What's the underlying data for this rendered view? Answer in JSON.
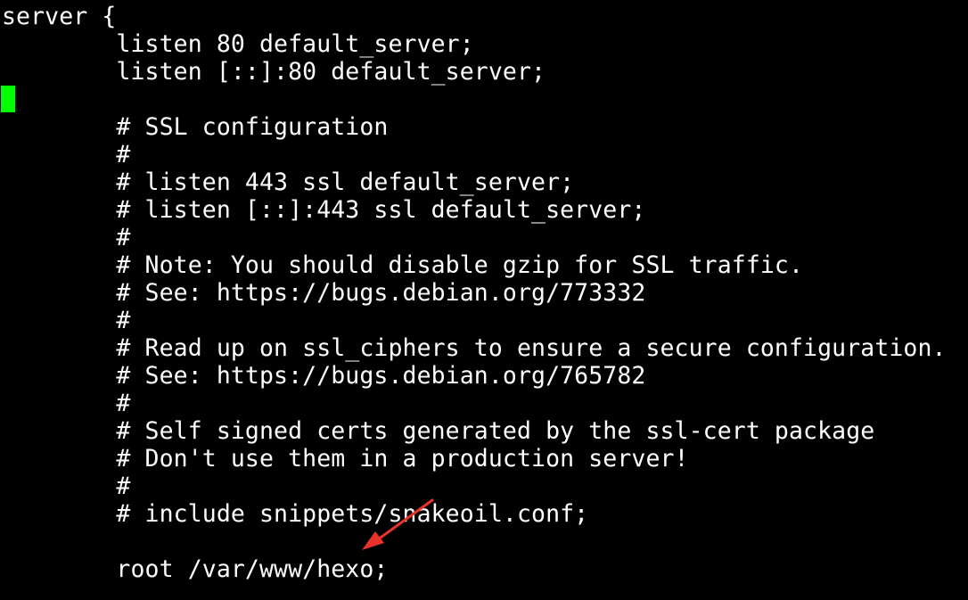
{
  "terminal": {
    "background": "#000000",
    "text_color": "#ffffff",
    "cursor_color": "#00ff00",
    "annotation_color": "#e8322a",
    "annotation_icon": "red-arrow-icon",
    "lines": [
      "server {",
      "        listen 80 default_server;",
      "        listen [::]:80 default_server;",
      "",
      "        # SSL configuration",
      "        #",
      "        # listen 443 ssl default_server;",
      "        # listen [::]:443 ssl default_server;",
      "        #",
      "        # Note: You should disable gzip for SSL traffic.",
      "        # See: https://bugs.debian.org/773332",
      "        #",
      "        # Read up on ssl_ciphers to ensure a secure configuration.",
      "        # See: https://bugs.debian.org/765782",
      "        #",
      "        # Self signed certs generated by the ssl-cert package",
      "        # Don't use them in a production server!",
      "        #",
      "        # include snippets/snakeoil.conf;",
      "",
      "        root /var/www/hexo;"
    ]
  }
}
